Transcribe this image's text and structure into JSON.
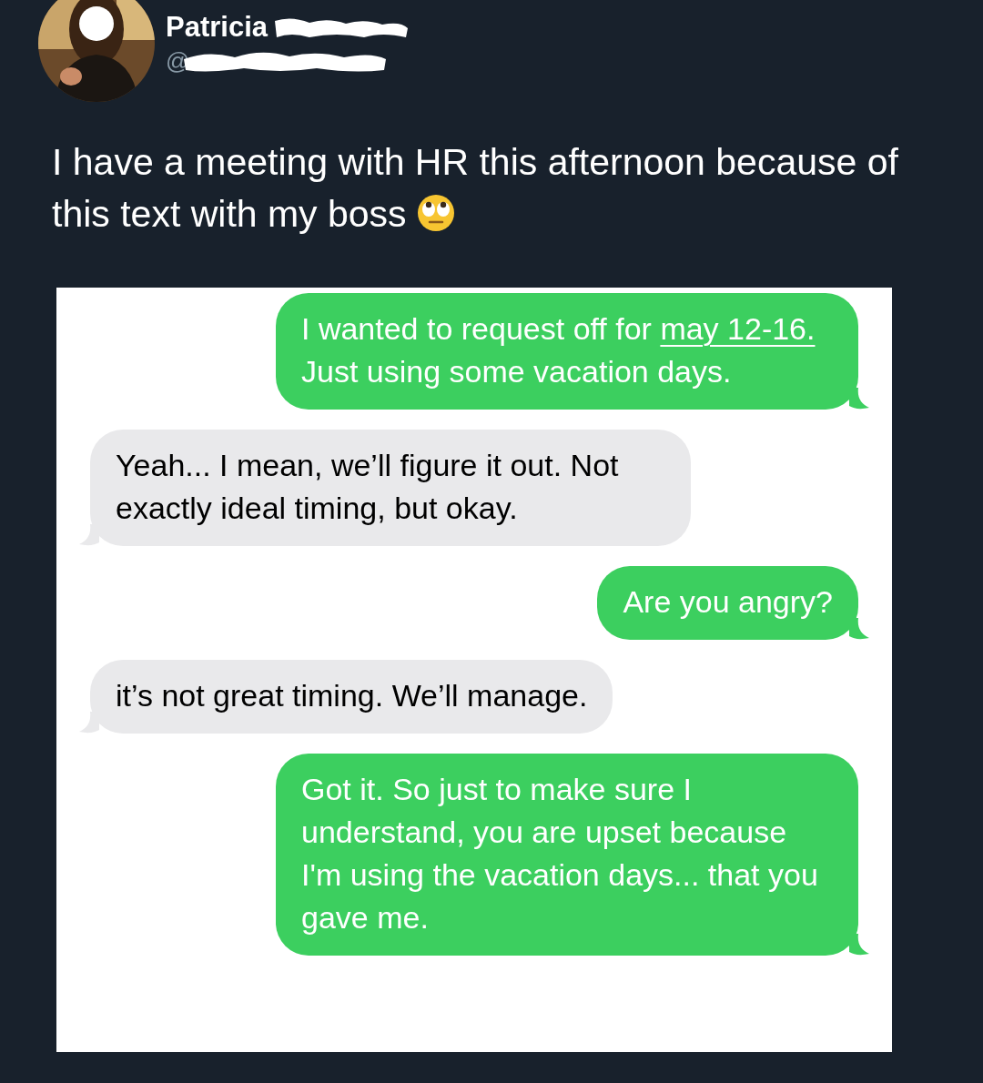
{
  "author": {
    "name": "Patricia",
    "handle": "@"
  },
  "tweet": {
    "text": "I have a meeting with HR this afternoon because of this text with my boss"
  },
  "messages": [
    {
      "kind": "sent",
      "segments": [
        {
          "text": "I wanted to request off for ",
          "underlined": false
        },
        {
          "text": "may 12-16.",
          "underlined": true
        },
        {
          "text": " Just using some vacation days.",
          "underlined": false
        }
      ]
    },
    {
      "kind": "received",
      "segments": [
        {
          "text": "Yeah... I mean, we’ll figure it out. Not exactly ideal timing, but okay.",
          "underlined": false
        }
      ]
    },
    {
      "kind": "sent",
      "segments": [
        {
          "text": "Are you angry?",
          "underlined": false
        }
      ]
    },
    {
      "kind": "received",
      "segments": [
        {
          "text": "it’s not great timing. We’ll manage.",
          "underlined": false
        }
      ]
    },
    {
      "kind": "sent",
      "segments": [
        {
          "text": "Got it. So just to make sure I understand, you are upset because I'm using the vacation days... that you gave me.",
          "underlined": false
        }
      ]
    }
  ]
}
